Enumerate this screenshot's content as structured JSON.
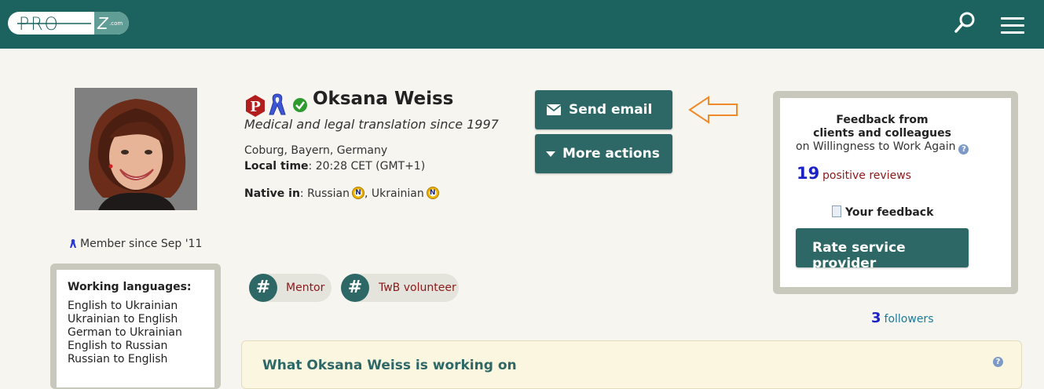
{
  "header": {
    "logo_text": "PRO",
    "logo_suffix": "Z",
    "logo_domain": ".com",
    "search_icon": "search-icon",
    "menu_icon": "hamburger-menu-icon",
    "bg_color": "#1c6360"
  },
  "profile": {
    "name": "Oksana Weiss",
    "tagline": "Medical and legal translation since 1997",
    "location": "Coburg, Bayern, Germany",
    "local_time_label": "Local time",
    "local_time_value": ": 20:28 CET (GMT+1)",
    "native_label": "Native in",
    "native_sep": ": ",
    "native_lang_1": "Russian",
    "native_comma": ", ",
    "native_lang_2": "Ukrainian",
    "member_since": "Member since Sep '11",
    "badge_letter": "P"
  },
  "actions": {
    "send_email": "Send email",
    "more_actions": "More actions"
  },
  "tags": [
    {
      "hash": "#",
      "label": "Mentor"
    },
    {
      "hash": "#",
      "label": "TwB volunteer"
    }
  ],
  "working_languages": {
    "title": "Working languages:",
    "items": [
      "English to Ukrainian",
      "Ukrainian to English",
      "German to Ukrainian",
      "English to Russian",
      "Russian to English"
    ]
  },
  "feedback": {
    "title_line1": "Feedback from",
    "title_line2": "clients and colleagues",
    "subtitle": "on Willingness to Work Again",
    "count": "19",
    "count_label": "positive reviews",
    "your_feedback": "Your feedback",
    "rate_button": "Rate service provider"
  },
  "followers": {
    "count": "3",
    "label": "followers"
  },
  "working_on": {
    "title": "What Oksana Weiss is working on"
  },
  "colors": {
    "button": "#2d6866",
    "accent_link": "#8b1a1a",
    "count_blue": "#1c23c4",
    "arrow_orange": "#f08a2a"
  }
}
